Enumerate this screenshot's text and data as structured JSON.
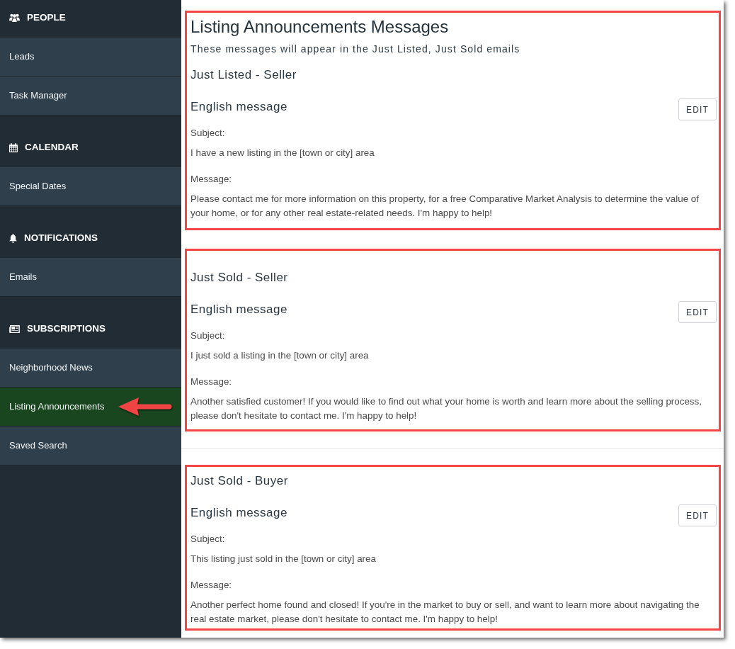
{
  "sidebar": {
    "groups": [
      {
        "title": "PEOPLE",
        "items": [
          {
            "label": "Leads",
            "selected": false,
            "callout_arrow": false
          },
          {
            "label": "Task Manager",
            "selected": false,
            "callout_arrow": false
          }
        ]
      },
      {
        "title": "CALENDAR",
        "items": [
          {
            "label": "Special Dates",
            "selected": false,
            "callout_arrow": false
          }
        ]
      },
      {
        "title": "NOTIFICATIONS",
        "items": [
          {
            "label": "Emails",
            "selected": false,
            "callout_arrow": false
          }
        ]
      },
      {
        "title": "SUBSCRIPTIONS",
        "items": [
          {
            "label": "Neighborhood News",
            "selected": false,
            "callout_arrow": false
          },
          {
            "label": "Listing Announcements",
            "selected": true,
            "callout_arrow": true
          },
          {
            "label": "Saved Search",
            "selected": false,
            "callout_arrow": false
          }
        ]
      }
    ]
  },
  "header": {
    "title": "Listing Announcements Messages",
    "subtitle": "These messages will appear in the Just Listed, Just Sold emails"
  },
  "templates": [
    {
      "highlighted": true,
      "title": "Just Listed - Seller",
      "language_heading": "English message",
      "edit_button": "EDIT",
      "subject_label": "Subject:",
      "subject": "I have a new listing in the [town or city] area",
      "message_label": "Message:",
      "message": "Please contact me for more information on this property, for a free Comparative Market Analysis to determine the value of your home, or for any other real estate-related needs. I'm happy to help!"
    },
    {
      "highlighted": true,
      "title": "Just Sold - Seller",
      "language_heading": "English message",
      "edit_button": "EDIT",
      "subject_label": "Subject:",
      "subject": "I just sold a listing in the [town or city] area",
      "message_label": "Message:",
      "message": "Another satisfied customer! If you would like to find out what your home is worth and learn more about the selling process, please don't hesitate to contact me. I'm happy to help!"
    },
    {
      "highlighted": true,
      "title": "Just Sold - Buyer",
      "language_heading": "English message",
      "edit_button": "EDIT",
      "subject_label": "Subject:",
      "subject": "This listing just sold in the [town or city] area",
      "message_label": "Message:",
      "message": "Another perfect home found and closed! If you're in the market to buy or sell, and want to learn more about navigating the real estate market, please don't hesitate to contact me. I'm happy to help!"
    }
  ]
}
